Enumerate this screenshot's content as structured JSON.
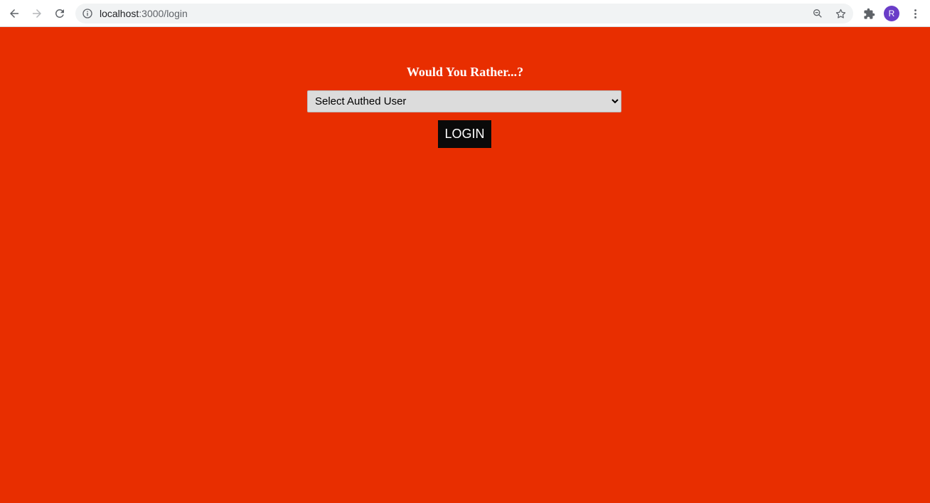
{
  "browser": {
    "url_host": "localhost",
    "url_path": ":3000/login",
    "profile_initial": "R"
  },
  "login": {
    "title": "Would You Rather...?",
    "select_placeholder": "Select Authed User",
    "login_button": "LOGIN"
  },
  "colors": {
    "page_background": "#e82e00",
    "button_background": "#0a0a0a",
    "avatar": "#6a3dc8"
  }
}
